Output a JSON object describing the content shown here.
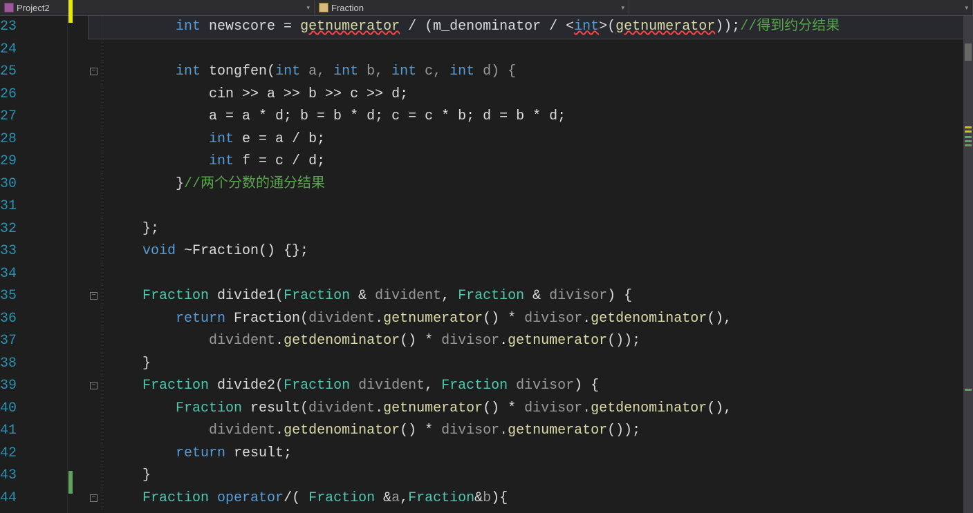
{
  "topbar": {
    "project": "Project2",
    "scope": "Fraction"
  },
  "line_numbers": [
    "23",
    "24",
    "25",
    "26",
    "27",
    "28",
    "29",
    "30",
    "31",
    "32",
    "33",
    "34",
    "35",
    "36",
    "37",
    "38",
    "39",
    "40",
    "41",
    "42",
    "43",
    "44"
  ],
  "code": {
    "l23_a": "int",
    "l23_b": " newscore = ",
    "l23_c": "getnumerator",
    "l23_d": " / (m_denominator / <",
    "l23_e": "int",
    "l23_f": ">(",
    "l23_g": "getnumerator",
    "l23_h": "));",
    "l23_cmt": "//得到约分结果",
    "l25_a": "int",
    "l25_b": " tongfen(",
    "l25_c": "int",
    "l25_d": " a, ",
    "l25_e": "int",
    "l25_f": " b, ",
    "l25_g": "int",
    "l25_h": " c, ",
    "l25_i": "int",
    "l25_j": " d) {",
    "l26": "cin >> a >> b >> c >> d;",
    "l27": "a = a * d; b = b * d; c = c * b; d = b * d;",
    "l28_a": "int",
    "l28_b": " e = a / b;",
    "l29_a": "int",
    "l29_b": " f = c / d;",
    "l30_a": "}",
    "l30_cmt": "//两个分数的通分结果",
    "l32": "};",
    "l33_a": "void",
    "l33_b": " ~Fraction() {};",
    "l35_a": "Fraction",
    "l35_b": " divide1(",
    "l35_c": "Fraction",
    "l35_d": " & ",
    "l35_e": "divident",
    "l35_f": ", ",
    "l35_g": "Fraction",
    "l35_h": " & ",
    "l35_i": "divisor",
    "l35_j": ") {",
    "l36_a": "return",
    "l36_b": " Fraction(",
    "l36_c": "divident",
    "l36_d": ".",
    "l36_e": "getnumerator",
    "l36_f": "() * ",
    "l36_g": "divisor",
    "l36_h": ".",
    "l36_i": "getdenominator",
    "l36_j": "(),",
    "l37_a": "divident",
    "l37_b": ".",
    "l37_c": "getdenominator",
    "l37_d": "() * ",
    "l37_e": "divisor",
    "l37_f": ".",
    "l37_g": "getnumerator",
    "l37_h": "());",
    "l38": "}",
    "l39_a": "Fraction",
    "l39_b": " divide2(",
    "l39_c": "Fraction",
    "l39_d": " ",
    "l39_e": "divident",
    "l39_f": ", ",
    "l39_g": "Fraction",
    "l39_h": " ",
    "l39_i": "divisor",
    "l39_j": ") {",
    "l40_a": "Fraction",
    "l40_b": " result(",
    "l40_c": "divident",
    "l40_d": ".",
    "l40_e": "getnumerator",
    "l40_f": "() * ",
    "l40_g": "divisor",
    "l40_h": ".",
    "l40_i": "getdenominator",
    "l40_j": "(),",
    "l41_a": "divident",
    "l41_b": ".",
    "l41_c": "getdenominator",
    "l41_d": "() * ",
    "l41_e": "divisor",
    "l41_f": ".",
    "l41_g": "getnumerator",
    "l41_h": "());",
    "l42_a": "return",
    "l42_b": " result;",
    "l43": "}",
    "l44_a": "Fraction",
    "l44_b": " ",
    "l44_c": "operator",
    "l44_d": "/( ",
    "l44_e": "Fraction",
    "l44_f": " &",
    "l44_g": "a",
    "l44_h": ",",
    "l44_i": "Fraction",
    "l44_j": "&",
    "l44_k": "b",
    "l44_l": "){"
  }
}
